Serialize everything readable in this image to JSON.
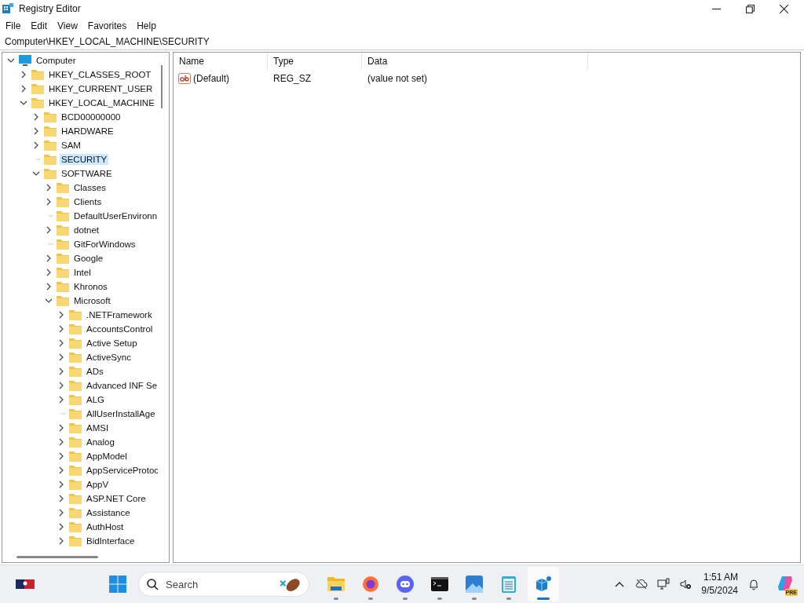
{
  "window": {
    "title": "Registry Editor"
  },
  "menu": [
    "File",
    "Edit",
    "View",
    "Favorites",
    "Help"
  ],
  "address": "Computer\\HKEY_LOCAL_MACHINE\\SECURITY",
  "tree": [
    {
      "label": "Computer",
      "kind": "computer",
      "expandable": true,
      "expanded": true,
      "selected": false,
      "children": [
        {
          "label": "HKEY_CLASSES_ROOT",
          "expandable": true,
          "expanded": false,
          "selected": false
        },
        {
          "label": "HKEY_CURRENT_USER",
          "expandable": true,
          "expanded": false,
          "selected": false
        },
        {
          "label": "HKEY_LOCAL_MACHINE",
          "expandable": true,
          "expanded": true,
          "selected": false,
          "children": [
            {
              "label": "BCD00000000",
              "expandable": true,
              "expanded": false,
              "selected": false
            },
            {
              "label": "HARDWARE",
              "expandable": true,
              "expanded": false,
              "selected": false
            },
            {
              "label": "SAM",
              "expandable": true,
              "expanded": false,
              "selected": false
            },
            {
              "label": "SECURITY",
              "expandable": false,
              "selected": true
            },
            {
              "label": "SOFTWARE",
              "expandable": true,
              "expanded": true,
              "selected": false,
              "children": [
                {
                  "label": "Classes",
                  "expandable": true,
                  "expanded": false,
                  "selected": false
                },
                {
                  "label": "Clients",
                  "expandable": true,
                  "expanded": false,
                  "selected": false
                },
                {
                  "label": "DefaultUserEnvironn",
                  "expandable": false,
                  "selected": false
                },
                {
                  "label": "dotnet",
                  "expandable": true,
                  "expanded": false,
                  "selected": false
                },
                {
                  "label": "GitForWindows",
                  "expandable": false,
                  "selected": false
                },
                {
                  "label": "Google",
                  "expandable": true,
                  "expanded": false,
                  "selected": false
                },
                {
                  "label": "Intel",
                  "expandable": true,
                  "expanded": false,
                  "selected": false
                },
                {
                  "label": "Khronos",
                  "expandable": true,
                  "expanded": false,
                  "selected": false
                },
                {
                  "label": "Microsoft",
                  "expandable": true,
                  "expanded": true,
                  "selected": false,
                  "children": [
                    {
                      "label": ".NETFramework",
                      "expandable": true,
                      "expanded": false,
                      "selected": false
                    },
                    {
                      "label": "AccountsControl",
                      "expandable": true,
                      "expanded": false,
                      "selected": false
                    },
                    {
                      "label": "Active Setup",
                      "expandable": true,
                      "expanded": false,
                      "selected": false
                    },
                    {
                      "label": "ActiveSync",
                      "expandable": true,
                      "expanded": false,
                      "selected": false
                    },
                    {
                      "label": "ADs",
                      "expandable": true,
                      "expanded": false,
                      "selected": false
                    },
                    {
                      "label": "Advanced INF Se",
                      "expandable": true,
                      "expanded": false,
                      "selected": false
                    },
                    {
                      "label": "ALG",
                      "expandable": true,
                      "expanded": false,
                      "selected": false
                    },
                    {
                      "label": "AllUserInstallAge",
                      "expandable": false,
                      "selected": false
                    },
                    {
                      "label": "AMSI",
                      "expandable": true,
                      "expanded": false,
                      "selected": false
                    },
                    {
                      "label": "Analog",
                      "expandable": true,
                      "expanded": false,
                      "selected": false
                    },
                    {
                      "label": "AppModel",
                      "expandable": true,
                      "expanded": false,
                      "selected": false
                    },
                    {
                      "label": "AppServiceProtoc",
                      "expandable": true,
                      "expanded": false,
                      "selected": false
                    },
                    {
                      "label": "AppV",
                      "expandable": true,
                      "expanded": false,
                      "selected": false
                    },
                    {
                      "label": "ASP.NET Core",
                      "expandable": true,
                      "expanded": false,
                      "selected": false
                    },
                    {
                      "label": "Assistance",
                      "expandable": true,
                      "expanded": false,
                      "selected": false
                    },
                    {
                      "label": "AuthHost",
                      "expandable": true,
                      "expanded": false,
                      "selected": false
                    },
                    {
                      "label": "BidInterface",
                      "expandable": true,
                      "expanded": false,
                      "selected": false
                    }
                  ]
                }
              ]
            }
          ]
        }
      ]
    }
  ],
  "values": {
    "columns": [
      "Name",
      "Type",
      "Data"
    ],
    "rows": [
      {
        "name": "(Default)",
        "type": "REG_SZ",
        "data": "(value not set)",
        "kind": "string"
      }
    ]
  },
  "taskbar": {
    "search": {
      "placeholder": "Search"
    },
    "apps": [
      {
        "kind": "files",
        "running": true,
        "active": false
      },
      {
        "kind": "firefox",
        "running": true,
        "active": false
      },
      {
        "kind": "discord",
        "running": true,
        "active": false
      },
      {
        "kind": "terminal",
        "running": true,
        "active": false
      },
      {
        "kind": "photos",
        "running": true,
        "active": false
      },
      {
        "kind": "notepad",
        "running": true,
        "active": false
      },
      {
        "kind": "regedit",
        "running": true,
        "active": true
      }
    ],
    "time": "1:51 AM",
    "date": "9/5/2024",
    "copilot_badge": "PRE"
  }
}
